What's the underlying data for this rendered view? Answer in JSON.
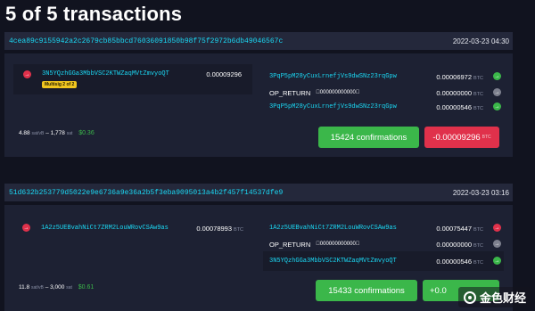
{
  "page": {
    "title": "5 of 5 transactions"
  },
  "tx1": {
    "txid": "4cea89c9155942a2c2679cb85bbcd76036091850b98f75f2972b6db49046567c",
    "time": "2022-03-23 04:30",
    "inputs": [
      {
        "address": "3N5YQzhGGa3MbbVSC2KTWZaqMVtZmvyoQT",
        "amount": "0.00009296",
        "badge": "Multisig 2 of 2"
      }
    ],
    "outputs": [
      {
        "address": "3PqP5pM28yCuxLrnefjVs9dwSNz23rqGpw",
        "amount": "0.00006972",
        "unit": "BTC",
        "status": "green"
      },
      {
        "label": "OP_RETURN",
        "script": "\u0000000000000000\u0000",
        "amount": "0.00000000",
        "unit": "BTC",
        "status": "grey"
      },
      {
        "address": "3PqP5pM28yCuxLrnefjVs9dwSNz23rqGpw",
        "amount": "0.00000546",
        "unit": "BTC",
        "status": "green"
      }
    ],
    "fee_rate": "4.88",
    "fee_rate_unit": "sat/vB",
    "fee_sat": "1,778",
    "fee_sat_unit": "sat",
    "fee_usd": "$0.36",
    "confirmations": "15424 confirmations",
    "total": "-0.00009296",
    "total_unit": "BTC"
  },
  "tx2": {
    "txid": "51d632b253779d5022e9e6736a9e36a2b5f3eba9095013a4b2f457f14537dfe9",
    "time": "2022-03-23 03:16",
    "inputs": [
      {
        "address": "1A2z5UEBvahNiCt7ZRM2LouWRovCSAw9as",
        "amount": "0.00078993",
        "unit": "BTC"
      }
    ],
    "outputs": [
      {
        "address": "1A2z5UEBvahNiCt7ZRM2LouWRovCSAw9as",
        "amount": "0.00075447",
        "unit": "BTC",
        "status": "red"
      },
      {
        "label": "OP_RETURN",
        "script": "\u0000000000000000\u0000",
        "amount": "0.00000000",
        "unit": "BTC",
        "status": "grey"
      },
      {
        "address": "3N5YQzhGGa3MbbVSC2KTWZaqMVtZmvyoQT",
        "amount": "0.00000546",
        "unit": "BTC",
        "status": "green"
      }
    ],
    "fee_rate": "11.8",
    "fee_rate_unit": "sat/vB",
    "fee_sat": "3,000",
    "fee_sat_unit": "sat",
    "fee_usd": "$0.61",
    "confirmations": "15433 confirmations",
    "total_prefix": "+0.0"
  },
  "watermark": {
    "text": "金色财经"
  }
}
